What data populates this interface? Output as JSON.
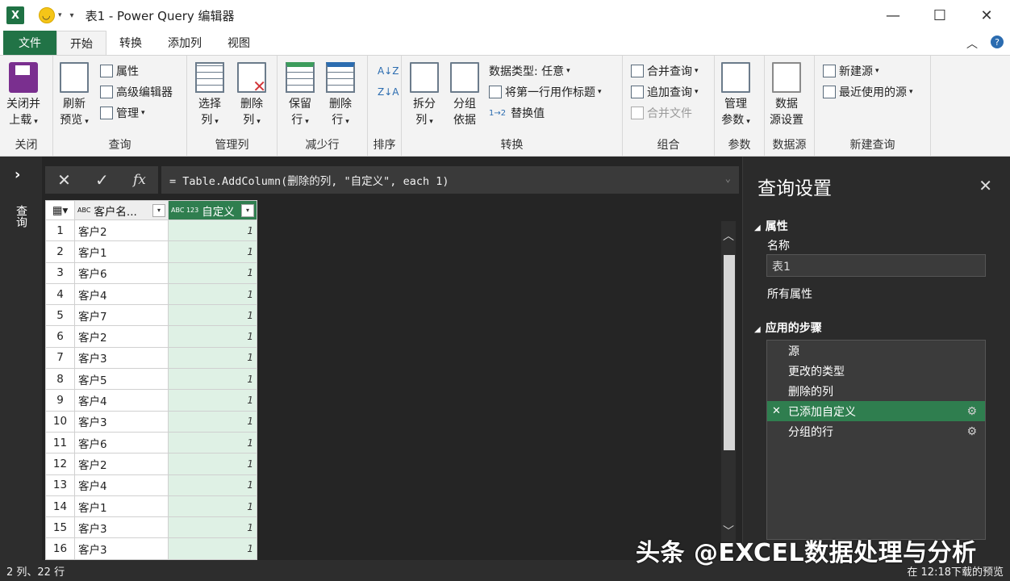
{
  "window": {
    "title": "表1 - Power Query 编辑器",
    "minimize": "—",
    "maximize": "☐",
    "close": "✕"
  },
  "ribbon_tabs": [
    "文件",
    "开始",
    "转换",
    "添加列",
    "视图"
  ],
  "ribbon_controls": {
    "collapse": "︿",
    "help": "?"
  },
  "groups": {
    "close": {
      "label": "关闭",
      "btn": "关闭并",
      "btn2": "上载"
    },
    "query": {
      "label": "查询",
      "refresh": "刷新",
      "refresh2": "预览",
      "properties": "属性",
      "advanced_editor": "高级编辑器",
      "manage": "管理"
    },
    "manage_columns": {
      "label": "管理列",
      "choose": "选择",
      "choose2": "列",
      "remove": "删除",
      "remove2": "列"
    },
    "reduce_rows": {
      "label": "减少行",
      "keep": "保留",
      "keep2": "行",
      "remove": "删除",
      "remove2": "行"
    },
    "sort": {
      "label": "排序"
    },
    "transform": {
      "label": "转换",
      "split": "拆分",
      "split2": "列",
      "groupby": "分组",
      "groupby2": "依据",
      "datatype": "数据类型: 任意",
      "first_row": "将第一行用作标题",
      "replace": "替换值"
    },
    "combine": {
      "label": "组合",
      "merge": "合并查询",
      "append": "追加查询",
      "combine_files": "合并文件"
    },
    "params": {
      "label": "参数",
      "manage": "管理",
      "manage2": "参数"
    },
    "datasource": {
      "label": "数据源",
      "settings": "数据",
      "settings2": "源设置"
    },
    "new_query": {
      "label": "新建查询",
      "new_source": "新建源",
      "recent": "最近使用的源"
    }
  },
  "left_pane": {
    "label": "查询",
    "expand": "›"
  },
  "formula_bar": {
    "cancel": "✕",
    "confirm": "✓",
    "fx": "fx",
    "formula": "= Table.AddColumn(删除的列, \"自定义\", each 1)"
  },
  "table": {
    "headers": [
      {
        "type": "ABC",
        "name": "客户名..."
      },
      {
        "type": "ABC 123",
        "name": "自定义"
      }
    ],
    "rows": [
      [
        "1",
        "客户2",
        "1"
      ],
      [
        "2",
        "客户1",
        "1"
      ],
      [
        "3",
        "客户6",
        "1"
      ],
      [
        "4",
        "客户4",
        "1"
      ],
      [
        "5",
        "客户7",
        "1"
      ],
      [
        "6",
        "客户2",
        "1"
      ],
      [
        "7",
        "客户3",
        "1"
      ],
      [
        "8",
        "客户5",
        "1"
      ],
      [
        "9",
        "客户4",
        "1"
      ],
      [
        "10",
        "客户3",
        "1"
      ],
      [
        "11",
        "客户6",
        "1"
      ],
      [
        "12",
        "客户2",
        "1"
      ],
      [
        "13",
        "客户4",
        "1"
      ],
      [
        "14",
        "客户1",
        "1"
      ],
      [
        "15",
        "客户3",
        "1"
      ],
      [
        "16",
        "客户3",
        "1"
      ]
    ]
  },
  "settings": {
    "title": "查询设置",
    "properties_header": "属性",
    "name_label": "名称",
    "name_value": "表1",
    "all_properties": "所有属性",
    "steps_header": "应用的步骤",
    "steps": [
      "源",
      "更改的类型",
      "删除的列",
      "已添加自定义",
      "分组的行"
    ]
  },
  "status": {
    "left": "2 列、22 行",
    "right": "在 12:18下载的预览"
  },
  "watermark": "头条 @EXCEL数据处理与分析",
  "colors": {
    "accent_green": "#2f7e4f",
    "file_tab": "#217346",
    "selected_col_bg": "#dff1e5"
  }
}
